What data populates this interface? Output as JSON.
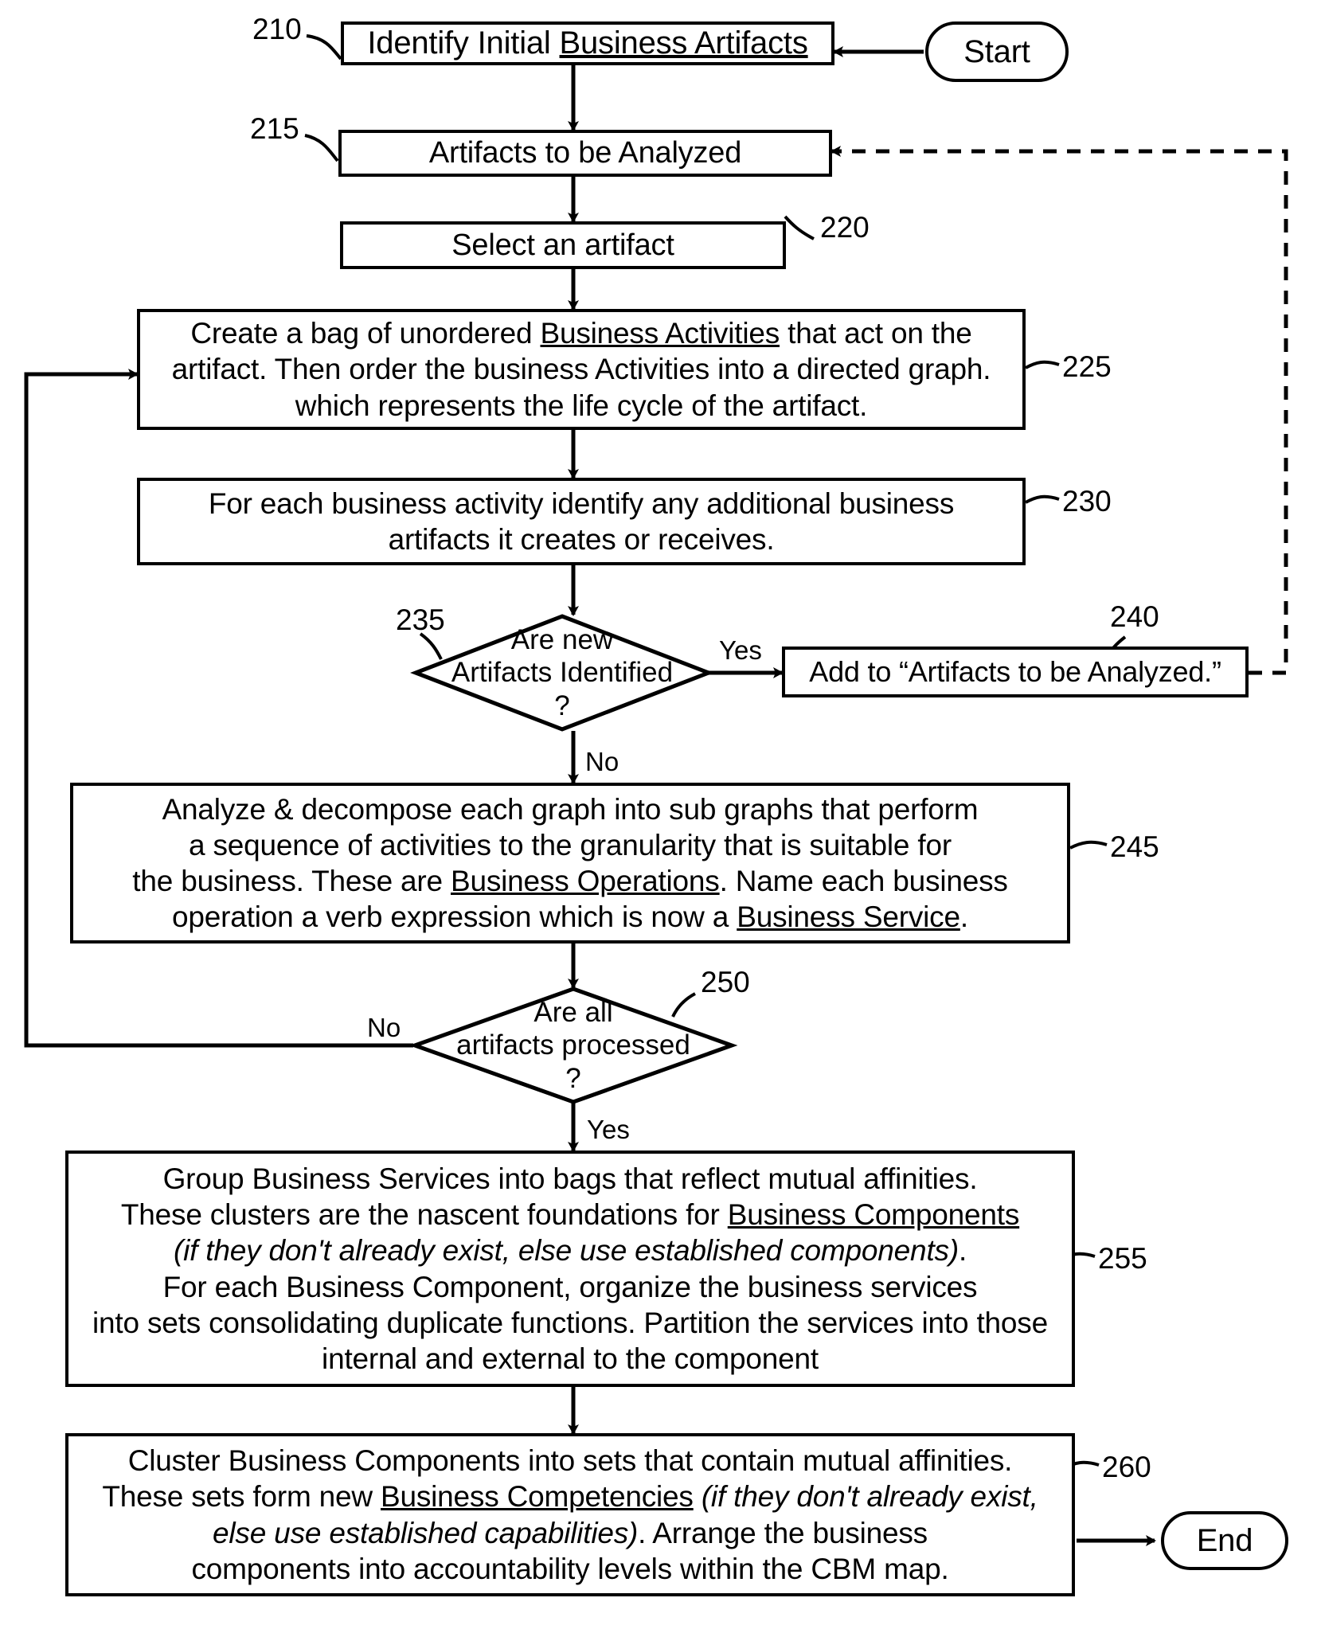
{
  "figure": {
    "type": "patent-flowchart",
    "nodes": [
      {
        "ref": "210",
        "shape": "process",
        "lines": [
          "Identify Initial ",
          "Business Artifacts"
        ]
      },
      {
        "ref": "215",
        "shape": "process",
        "lines": [
          "Artifacts to be Analyzed"
        ]
      },
      {
        "ref": "220",
        "shape": "process",
        "lines": [
          "Select an artifact"
        ]
      },
      {
        "ref": "225",
        "shape": "process",
        "lines": [
          "Create a bag of unordered Business Activities that act on the",
          "artifact. Then order the business Activities into a directed graph.",
          "which represents the life cycle of the artifact."
        ]
      },
      {
        "ref": "230",
        "shape": "process",
        "lines": [
          "For each business activity identify any additional business",
          "artifacts it creates or receives."
        ]
      },
      {
        "ref": "235",
        "shape": "decision",
        "lines": [
          "Are new",
          "Artifacts Identified",
          "?"
        ]
      },
      {
        "ref": "240",
        "shape": "process",
        "lines": [
          "Add to “Artifacts to be Analyzed.”"
        ]
      },
      {
        "ref": "245",
        "shape": "process",
        "lines": [
          "Analyze & decompose each graph into sub graphs that perform",
          "a sequence of activities to the granularity that is suitable for",
          "the business.  These are Business Operations. Name each business",
          "operation a verb expression which is now a Business Service."
        ]
      },
      {
        "ref": "250",
        "shape": "decision",
        "lines": [
          "Are all",
          "artifacts processed",
          "?"
        ]
      },
      {
        "ref": "255",
        "shape": "process",
        "lines": [
          "Group Business Services  into bags that reflect mutual affinities.",
          "These clusters are the nascent foundations for Business Components",
          "(if they don't already exist, else use established components).",
          "For each Business Component, organize the business services",
          "into sets consolidating duplicate functions. Partition the services into those",
          "internal and external to the component"
        ]
      },
      {
        "ref": "260",
        "shape": "process",
        "lines": [
          "Cluster Business Components into sets that contain mutual affinities.",
          "These sets form new Business Competencies (if they don't already exist,",
          "else use established capabilities). Arrange the business",
          "components into accountability levels within the CBM map."
        ]
      }
    ],
    "terminators": {
      "start": "Start",
      "end": "End"
    },
    "edge_labels": {
      "yes_235": "Yes",
      "no_235": "No",
      "no_250": "No",
      "yes_250": "Yes"
    },
    "ref_numbers": {
      "n210": "210",
      "n215": "215",
      "n220": "220",
      "n225": "225",
      "n230": "230",
      "n235": "235",
      "n240": "240",
      "n245": "245",
      "n250": "250",
      "n255": "255",
      "n260": "260"
    },
    "box210": {
      "pre": "Identify Initial ",
      "underlined": "Business Artifacts"
    },
    "box215": {
      "text": "Artifacts to be Analyzed"
    },
    "box220": {
      "text": "Select an artifact"
    },
    "box225": {
      "l1a": "Create a bag of unordered ",
      "l1u": "Business Activities",
      "l1b": " that act on the",
      "l2": "artifact. Then order the business Activities into a directed graph.",
      "l3": "which represents the life cycle of the artifact."
    },
    "box230": {
      "l1": "For each business activity identify any additional business",
      "l2": "artifacts it creates or receives."
    },
    "dia235": {
      "l1": "Are new",
      "l2": "Artifacts Identified",
      "l3": "?"
    },
    "box240": {
      "text": "Add to “Artifacts to be Analyzed.”"
    },
    "box245": {
      "l1": "Analyze & decompose each graph into sub graphs that perform",
      "l2": "a sequence of activities to the granularity that is suitable for",
      "l3a": "the business.  These are ",
      "l3u": "Business Operations",
      "l3b": ". Name each business",
      "l4a": "operation a verb expression which is now a ",
      "l4u": "Business Service",
      "l4b": "."
    },
    "dia250": {
      "l1": "Are all",
      "l2": "artifacts processed",
      "l3": "?"
    },
    "box255": {
      "l1": "Group Business Services  into bags that reflect mutual affinities.",
      "l2a": "These clusters are the nascent foundations for ",
      "l2u": "Business Components",
      "l3i": "(if they don't already exist, else use established components)",
      "l3b": ".",
      "l4": "For each Business Component, organize the business services",
      "l5": "into sets consolidating duplicate functions. Partition the services into those",
      "l6": "internal and external to the component"
    },
    "box260": {
      "l1": "Cluster Business Components into sets that contain mutual affinities.",
      "l2a": "These sets form new ",
      "l2u": "Business Competencies",
      "l2i": " (if they don't already exist,",
      "l3i": "else use established capabilities)",
      "l3b": ". Arrange the business",
      "l4": "components into accountability levels within the CBM map."
    }
  }
}
